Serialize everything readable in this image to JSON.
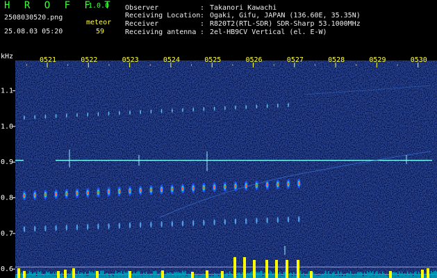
{
  "app": {
    "name": "H R O F F T",
    "version": "1.0.0"
  },
  "file": {
    "name": "2508030520.png",
    "datetime": "25.08.03 05:20"
  },
  "meteor": {
    "label": "meteor",
    "count": "59"
  },
  "station": [
    {
      "key": "Observer",
      "sep": ":",
      "value": "Takanori Kawachi"
    },
    {
      "key": "Receiving Location",
      "sep": ":",
      "value": "Ogaki, Gifu, JAPAN (136.60E, 35.35N)"
    },
    {
      "key": "Receiver",
      "sep": ":",
      "value": "R820T2(RTL-SDR) SDR-Sharp 53.1000MHz"
    },
    {
      "key": "Receiving antenna",
      "sep": ":",
      "value": "2el-HB9CV Vertical (el. E-W)"
    }
  ],
  "axes": {
    "y_unit": "kHz",
    "y_ticks": [
      "1.1",
      "1.0",
      "0.9",
      "0.8",
      "0.7",
      "0.6"
    ],
    "y_values": [
      1.1,
      1.0,
      0.9,
      0.8,
      0.7,
      0.6
    ],
    "x_ticks": [
      "0521",
      "0522",
      "0523",
      "0524",
      "0525",
      "0526",
      "0527",
      "0528",
      "0529",
      "0530"
    ],
    "y_range": [
      0.575,
      1.185
    ]
  },
  "colors": {
    "background": "#000000",
    "spectrogram_bg": "#00104a",
    "label_green": "#3cff3c",
    "label_yellow": "#ffff3c",
    "carrier": "#7fffff",
    "bars": "#ffff00"
  }
}
